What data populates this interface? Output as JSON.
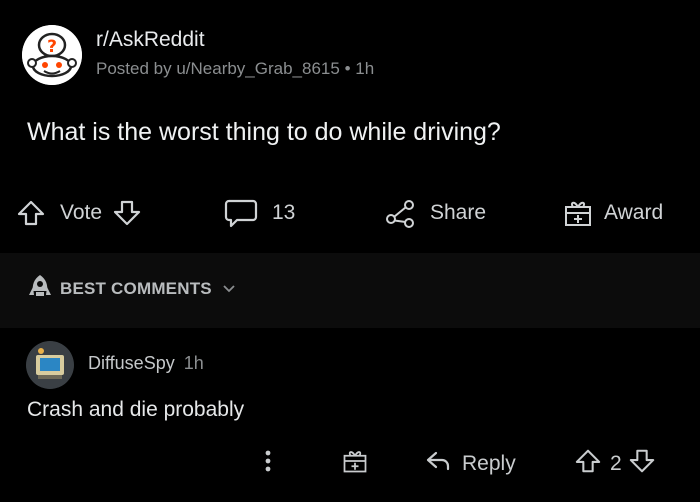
{
  "post": {
    "subreddit": "r/AskReddit",
    "posted_by": "Posted by u/Nearby_Grab_8615",
    "separator": "•",
    "age": "1h",
    "title": "What is the worst thing to do while driving?",
    "actions": {
      "vote_label": "Vote",
      "comment_count": "13",
      "share_label": "Share",
      "award_label": "Award"
    }
  },
  "comments_header": {
    "sort_label": "BEST COMMENTS"
  },
  "comment": {
    "username": "DiffuseSpy",
    "age": "1h",
    "body": "Crash and die probably",
    "reply_label": "Reply",
    "vote_count": "2"
  },
  "icons": [
    "reddit-snoo-question-icon",
    "upvote-arrow-icon",
    "downvote-arrow-icon",
    "comment-bubble-icon",
    "share-icon",
    "award-gift-icon",
    "rocket-icon",
    "chevron-down-icon",
    "more-dots-icon",
    "reply-arrow-icon"
  ],
  "colors": {
    "background": "#000000",
    "band": "#0c0c0c",
    "text": "#d7dadc",
    "muted": "#8b8e90"
  }
}
